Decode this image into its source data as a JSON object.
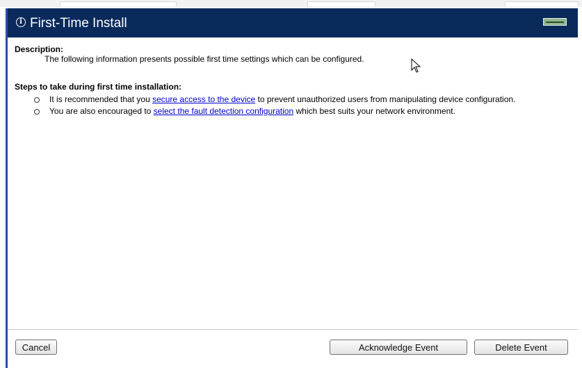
{
  "dialog": {
    "title": "First-Time Install",
    "info_icon": "info-icon",
    "device_icon": "device-icon"
  },
  "description": {
    "heading": "Description:",
    "text": "The following information presents possible first time settings which can be configured."
  },
  "steps": {
    "heading": "Steps to take during first time installation:",
    "items": [
      {
        "before": "It is recommended that you ",
        "link": "secure access to the device",
        "after": " to prevent unauthorized users from manipulating device configuration."
      },
      {
        "before": "You are also encouraged to ",
        "link": "select the fault detection configuration",
        "after": " which best suits your network environment."
      }
    ]
  },
  "buttons": {
    "cancel": "Cancel",
    "acknowledge": "Acknowledge Event",
    "delete": "Delete Event"
  },
  "colors": {
    "titlebar": "#0a2a5c",
    "link": "#0000cc"
  }
}
